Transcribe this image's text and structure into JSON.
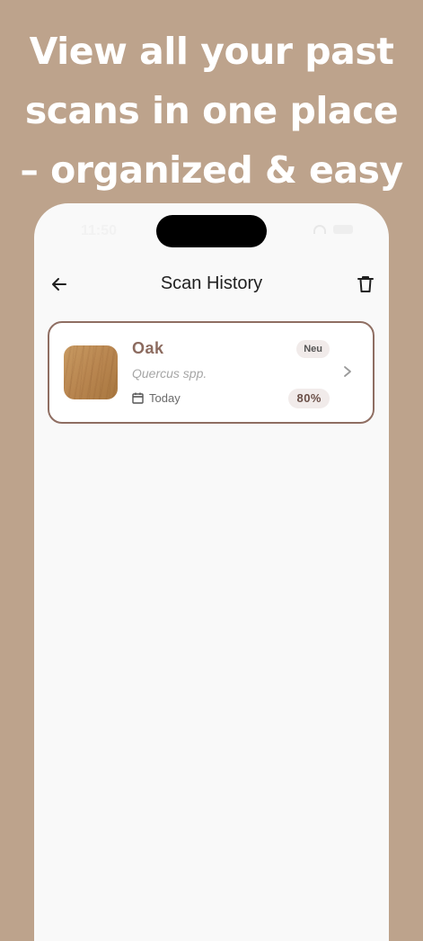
{
  "headline": {
    "line1": "View all your past",
    "line2": "scans in one place",
    "line3": "– organized & easy"
  },
  "status_bar": {
    "time": "11:50"
  },
  "navbar": {
    "title": "Scan History",
    "back_icon": "arrow-left-icon",
    "delete_icon": "trash-icon"
  },
  "scans": [
    {
      "name": "Oak",
      "species": "Quercus spp.",
      "date": "Today",
      "badge": "Neu",
      "confidence": "80%",
      "confidence_value": 0.8,
      "calendar_icon": "calendar-icon",
      "chevron_icon": "chevron-right-icon"
    }
  ],
  "colors": {
    "background": "#bda38c",
    "accent": "#8f6e62",
    "badge_bg": "#f1ebea",
    "screen_bg": "#f9f9f9"
  }
}
